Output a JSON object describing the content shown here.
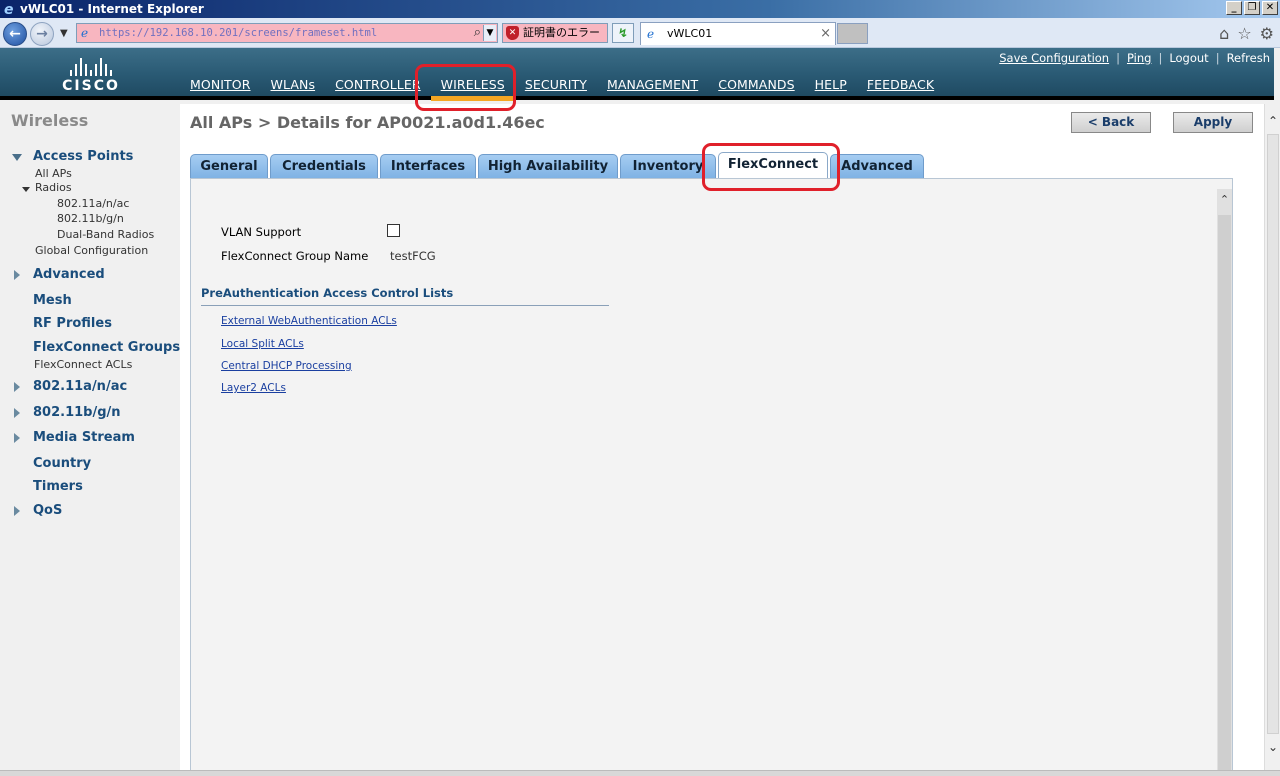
{
  "window": {
    "title": "vWLC01 - Internet Explorer",
    "btn_min": "_",
    "btn_max": "❐",
    "btn_close": "✕"
  },
  "browser": {
    "url": "https://192.168.10.201/screens/frameset.html",
    "cert_error": "証明書のエラー",
    "tab_title": "vWLC01",
    "tab_close": "×"
  },
  "header": {
    "brand": "CISCO",
    "top_links": [
      "Save Configuration",
      "Ping",
      "Logout",
      "Refresh"
    ],
    "menu": [
      "MONITOR",
      "WLANs",
      "CONTROLLER",
      "WIRELESS",
      "SECURITY",
      "MANAGEMENT",
      "COMMANDS",
      "HELP",
      "FEEDBACK"
    ],
    "active_menu": "WIRELESS"
  },
  "sidebar": {
    "title": "Wireless",
    "access_points": "Access Points",
    "all_aps": "All APs",
    "radios": "Radios",
    "radio_a": "802.11a/n/ac",
    "radio_b": "802.11b/g/n",
    "radio_dual": "Dual-Band Radios",
    "global_config": "Global Configuration",
    "advanced": "Advanced",
    "mesh": "Mesh",
    "rf_profiles": "RF Profiles",
    "flexconnect_groups": "FlexConnect Groups",
    "flexconnect_acls": "FlexConnect ACLs",
    "b80211a": "802.11a/n/ac",
    "b80211b": "802.11b/g/n",
    "media_stream": "Media Stream",
    "country": "Country",
    "timers": "Timers",
    "qos": "QoS"
  },
  "main": {
    "page_title": "All APs > Details for AP0021.a0d1.46ec",
    "back_label": "< Back",
    "apply_label": "Apply",
    "tabs": [
      "General",
      "Credentials",
      "Interfaces",
      "High Availability",
      "Inventory",
      "FlexConnect",
      "Advanced"
    ],
    "active_tab": "FlexConnect",
    "vlan_support_label": "VLAN Support",
    "vlan_support_checked": false,
    "group_name_label": "FlexConnect Group Name",
    "group_name_value": "testFCG",
    "section_title": "PreAuthentication Access Control Lists",
    "links": [
      "External WebAuthentication ACLs",
      "Local Split ACLs",
      "Central DHCP Processing",
      "Layer2 ACLs"
    ]
  },
  "colors": {
    "header_bg": "#2a5a74",
    "active_menu_underline": "#f5a623",
    "tab_bg": "#8fbde8",
    "highlight": "#e0202a",
    "link": "#1a3fa0"
  }
}
